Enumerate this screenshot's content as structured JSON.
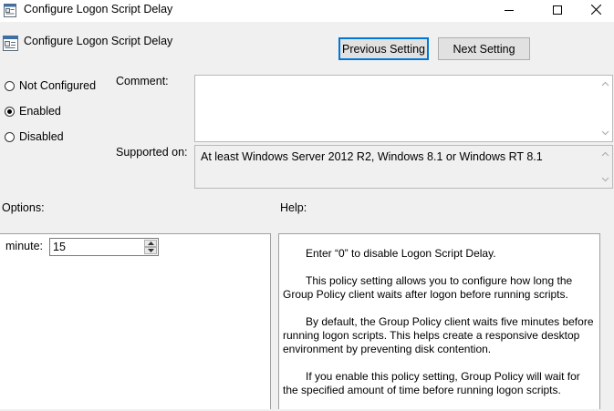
{
  "window": {
    "title": "Configure Logon Script Delay",
    "minimize_icon": "minimize-icon",
    "maximize_icon": "maximize-icon",
    "close_icon": "close-icon",
    "app_icon": "group-policy-setting-icon"
  },
  "header": {
    "title": "Configure Logon Script Delay",
    "prev_label": "Previous Setting",
    "next_label": "Next Setting"
  },
  "state": {
    "options": [
      {
        "label": "Not Configured",
        "selected": false
      },
      {
        "label": "Enabled",
        "selected": true
      },
      {
        "label": "Disabled",
        "selected": false
      }
    ]
  },
  "comment": {
    "label": "Comment:",
    "value": ""
  },
  "supported": {
    "label": "Supported on:",
    "value": "At least Windows Server 2012 R2, Windows 8.1 or Windows RT 8.1"
  },
  "options_panel": {
    "label": "Options:",
    "minute_label": "minute:",
    "minute_value": "15"
  },
  "help_panel": {
    "label": "Help:",
    "paragraphs": [
      "Enter “0” to disable Logon Script Delay.",
      "This policy setting allows you to configure how long the Group Policy client waits after logon before running scripts.",
      "By default, the Group Policy client waits five minutes before running logon scripts. This helps create a responsive desktop environment by preventing disk contention.",
      "If you enable this policy setting, Group Policy will wait for the specified amount of time before running logon scripts."
    ]
  },
  "colors": {
    "focus_border": "#0078d7",
    "window_bg": "#f0f0f0"
  }
}
